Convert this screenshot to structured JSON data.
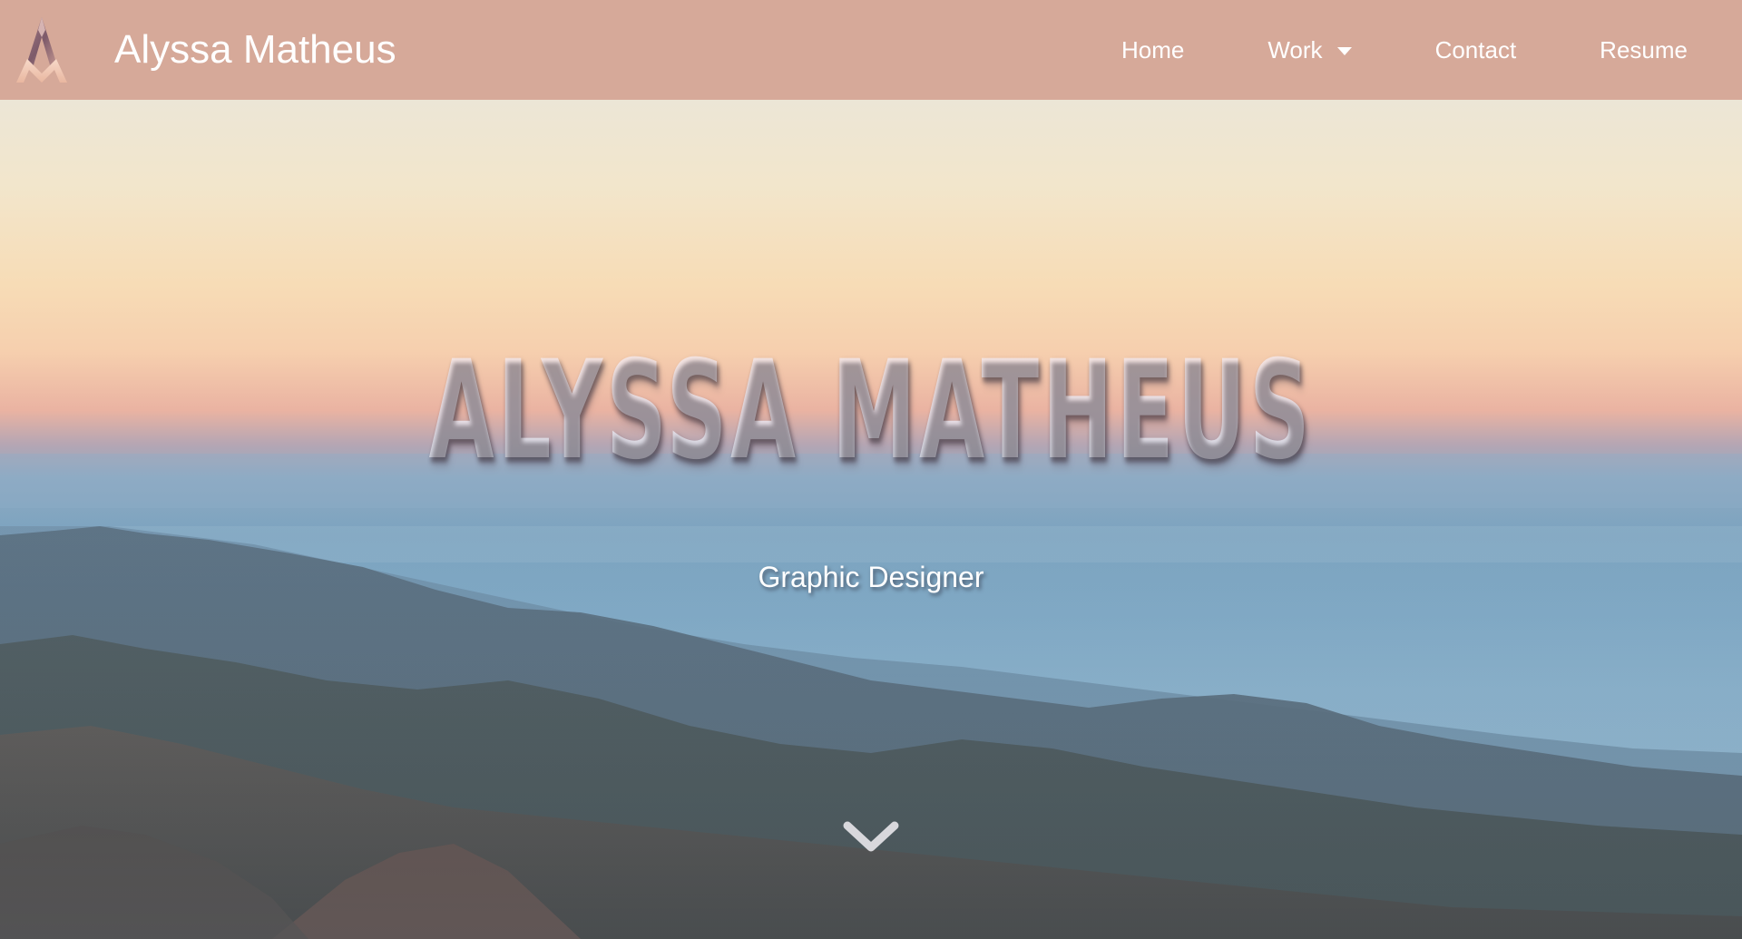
{
  "navbar": {
    "brand_name": "Alyssa Matheus",
    "logo_icon": "am-monogram-logo",
    "links": [
      {
        "label": "Home"
      },
      {
        "label": "Work",
        "has_dropdown": true
      },
      {
        "label": "Contact"
      },
      {
        "label": "Resume"
      }
    ],
    "background_color": "#d6a999"
  },
  "hero": {
    "title": "ALYSSA MATHEUS",
    "subtitle": "Graphic Designer",
    "scroll_icon": "chevron-down-icon",
    "background": "sunset-mountain-aerial-photo"
  }
}
